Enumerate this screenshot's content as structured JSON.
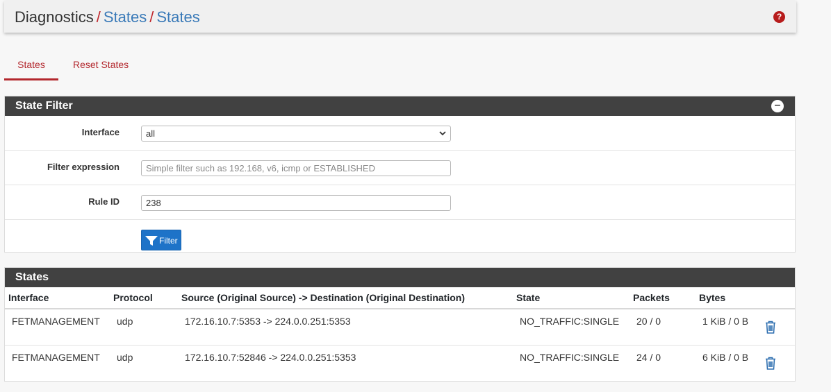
{
  "breadcrumb": {
    "root": "Diagnostics",
    "sep": "/",
    "level1": "States",
    "level2": "States"
  },
  "help_icon": "question-circle-icon",
  "tabs": [
    {
      "label": "States",
      "active": true
    },
    {
      "label": "Reset States",
      "active": false
    }
  ],
  "filter_panel": {
    "title": "State Filter",
    "interface_label": "Interface",
    "interface_value": "all",
    "filter_label": "Filter expression",
    "filter_placeholder": "Simple filter such as 192.168, v6, icmp or ESTABLISHED",
    "filter_value": "",
    "rule_label": "Rule ID",
    "rule_value": "238",
    "button_label": "Filter"
  },
  "states_panel": {
    "title": "States",
    "columns": [
      "Interface",
      "Protocol",
      "Source (Original Source) -> Destination (Original Destination)",
      "State",
      "Packets",
      "Bytes"
    ],
    "rows": [
      {
        "interface": "FETMANAGEMENT",
        "protocol": "udp",
        "route": "172.16.10.7:5353 -> 224.0.0.251:5353",
        "state": "NO_TRAFFIC:SINGLE",
        "packets": "20 / 0",
        "bytes": "1 KiB / 0 B"
      },
      {
        "interface": "FETMANAGEMENT",
        "protocol": "udp",
        "route": "172.16.10.7:52846 -> 224.0.0.251:5353",
        "state": "NO_TRAFFIC:SINGLE",
        "packets": "24 / 0",
        "bytes": "6 KiB / 0 B"
      }
    ]
  },
  "colors": {
    "accent": "#b3272d",
    "link": "#3a7ab8",
    "panel_header": "#414141",
    "button": "#1e73c8"
  }
}
